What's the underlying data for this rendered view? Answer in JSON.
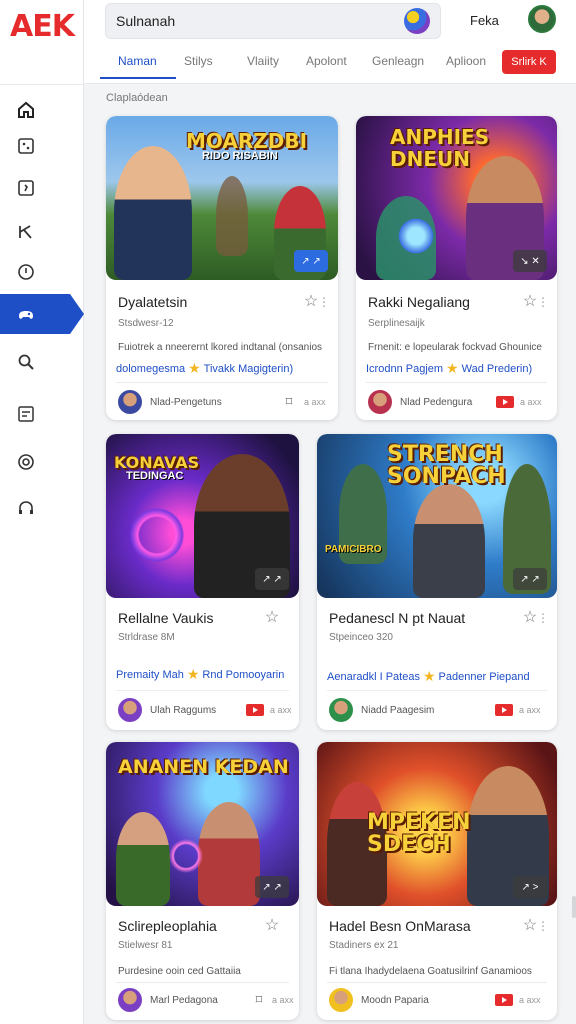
{
  "app": {
    "logo": "AEK"
  },
  "sidebar": {
    "items": [
      {
        "name": "home",
        "active": false
      },
      {
        "name": "dice",
        "active": false
      },
      {
        "name": "hash",
        "active": false
      },
      {
        "name": "tools",
        "active": false
      },
      {
        "name": "clock",
        "active": false
      },
      {
        "name": "gamepad",
        "active": true
      },
      {
        "name": "search",
        "active": false
      },
      {
        "name": "list",
        "active": false
      },
      {
        "name": "target",
        "active": false
      },
      {
        "name": "headset",
        "active": false
      }
    ]
  },
  "header": {
    "search_value": "Sulnanah",
    "user_name": "Feka",
    "tabs": [
      "Naman",
      "Stilys",
      "Vlaiity",
      "Apolont",
      "Genleagn",
      "Aplioon"
    ],
    "active_tab": "Naman",
    "action_button": "Srlirk K"
  },
  "section_label": "Claplaódean",
  "cards": [
    {
      "thumb_title": "MOARZDBI",
      "thumb_sub": "RIDO RISABIN",
      "title": "Dyalatetsin",
      "sub": "Stsdwesr-12",
      "desc": "Fuiotrek a nneerernt lkored indtanal (onsanios",
      "tagline_a": "dolomegesma",
      "tagline_b": "Tivakk Magigterin)",
      "author": "Nlad-Pengetuns",
      "count": "a axx",
      "badge": "↗ ↗"
    },
    {
      "thumb_title": "ANPHIES DNEUN",
      "thumb_sub": "",
      "title": "Rakki Negaliang",
      "sub": "Serplinesaijk",
      "desc": "Frnenit: e lopeularak fockvad Ghounice",
      "tagline_a": "Icrodnn Pagjem",
      "tagline_b": "Wad Prederin)",
      "author": "Nlad Pedengura",
      "count": "a axx",
      "badge": "↘ ✕"
    },
    {
      "thumb_title": "KONAVAS",
      "thumb_sub": "TEDINGAC",
      "title": "Rellalne Vaukis",
      "sub": "Strldrase 8M",
      "desc": "",
      "tagline_a": "Premaity Mah",
      "tagline_b": "Rnd Pomooyarin",
      "author": "Ulah Raggums",
      "count": "a axx",
      "badge": "↗ ↗"
    },
    {
      "thumb_title": "STRENCH SONPACH",
      "thumb_sub": "PAMICIBRO",
      "title": "Pedanescl N pt Nauat",
      "sub": "Stpeinceo 320",
      "desc": "",
      "tagline_a": "Aenaradkl I Pateas",
      "tagline_b": "Padenner Piepand",
      "author": "Niadd Paagesim",
      "count": "a axx",
      "badge": "↗ ↗"
    },
    {
      "thumb_title": "ANANEN KEDAN",
      "thumb_sub": "",
      "title": "Sclirepleoplahia",
      "sub": "Stielwesr 81",
      "desc": "Purdesine ooin ced Gattaiia",
      "tagline_a": "",
      "tagline_b": "",
      "author": "Marl Pedagona",
      "count": "a axx",
      "badge": "↗ ↗"
    },
    {
      "thumb_title": "MPEKEN SDECH",
      "thumb_sub": "",
      "title": "Hadel Besn OnMarasa",
      "sub": "Stadiners ex 21",
      "desc": "Fi tlana Ihadydelaena Goatusilrinf Ganamioos",
      "tagline_a": "",
      "tagline_b": "",
      "author": "Moodn Paparia",
      "count": "a axx",
      "badge": "↗ >"
    }
  ],
  "colors": {
    "accent": "#1f4fc7",
    "brand_red": "#e52b2b",
    "background": "#f3f4f6"
  }
}
